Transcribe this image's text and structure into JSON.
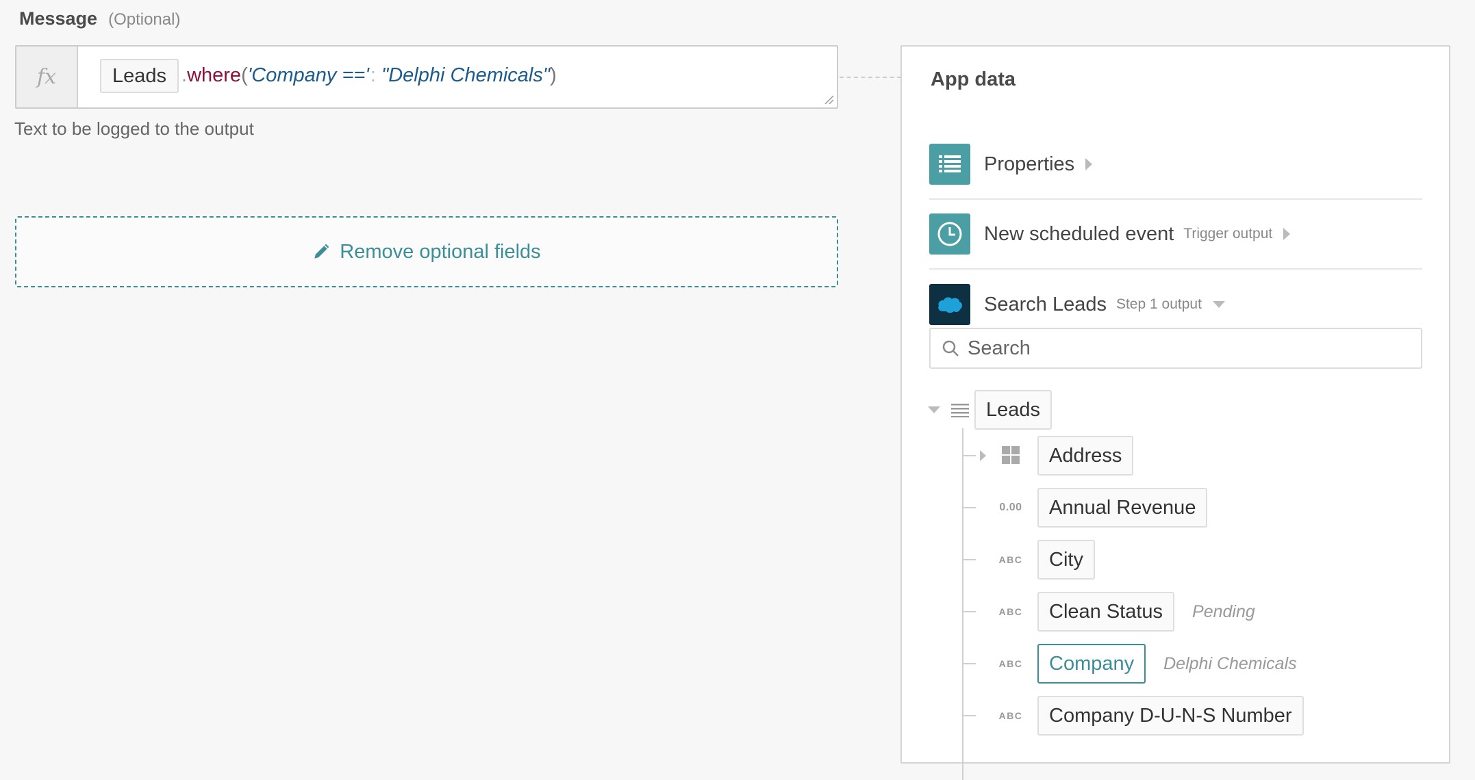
{
  "field": {
    "title": "Message",
    "optional_label": "(Optional)",
    "formula_icon": "fx",
    "formula": {
      "pill": "Leads",
      "dot": ".",
      "method": "where",
      "open_paren": "(",
      "arg_key": "'Company =='",
      "separator": ":",
      "arg_value": "\"Delphi Chemicals\"",
      "close_paren": ")"
    },
    "helper_text": "Text to be logged to the output"
  },
  "remove_fields": {
    "icon": "pencil-icon",
    "label": "Remove optional fields"
  },
  "app_data": {
    "title": "App data",
    "sources": [
      {
        "label": "Properties",
        "sub": "",
        "icon": "list-icon"
      },
      {
        "label": "New scheduled event",
        "sub": "Trigger output",
        "icon": "clock-icon"
      },
      {
        "label": "Search Leads",
        "sub": "Step 1 output",
        "icon": "salesforce-icon"
      }
    ],
    "search": {
      "placeholder": "Search",
      "value": ""
    },
    "tree": {
      "root": "Leads",
      "children": [
        {
          "type_icon": "grid-icon",
          "label": "Address",
          "sample": ""
        },
        {
          "type_icon": "0.00",
          "label": "Annual Revenue",
          "sample": ""
        },
        {
          "type_icon": "ABC",
          "label": "City",
          "sample": ""
        },
        {
          "type_icon": "ABC",
          "label": "Clean Status",
          "sample": "Pending"
        },
        {
          "type_icon": "ABC",
          "label": "Company",
          "sample": "Delphi Chemicals"
        },
        {
          "type_icon": "ABC",
          "label": "Company D-U-N-S Number",
          "sample": ""
        }
      ]
    }
  },
  "colors": {
    "accent": "#3b8d97",
    "teal_icon": "#4b9ea3",
    "navy_icon": "#0e3043",
    "method": "#8b1238",
    "string": "#1c5b8c",
    "background": "#f7f7f7"
  }
}
